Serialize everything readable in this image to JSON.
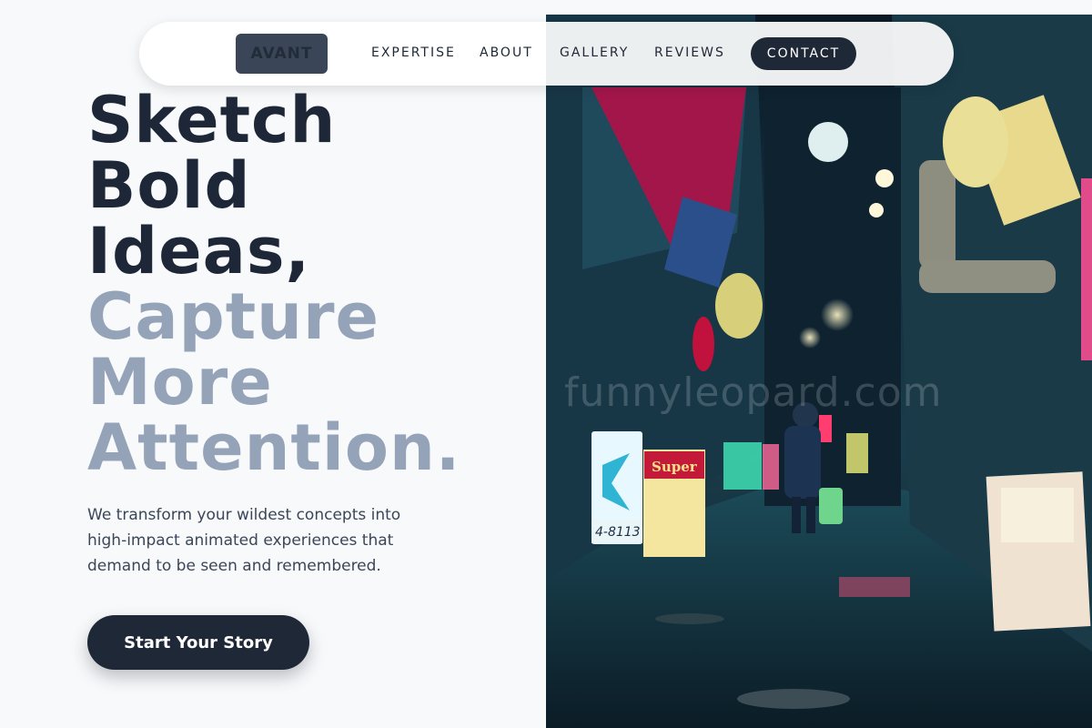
{
  "brand": {
    "logo_text": "AVANT"
  },
  "nav": {
    "links": [
      "EXPERTISE",
      "ABOUT",
      "GALLERY",
      "REVIEWS"
    ],
    "contact_label": "CONTACT"
  },
  "hero": {
    "headline_dark": [
      "Sketch",
      "Bold",
      "Ideas,"
    ],
    "headline_light": [
      "Capture",
      "More",
      "Attention."
    ],
    "subtext": "We transform your wildest concepts into high-impact animated experiences that demand to be seen and remembered.",
    "cta_label": "Start Your Story"
  },
  "image": {
    "watermark": "funnyleopard.com",
    "sign_super": "Super",
    "sign_number": "4-8113"
  },
  "colors": {
    "primary": "#1f2837",
    "muted_heading": "#94a3b8",
    "background": "#f8f9fb"
  }
}
